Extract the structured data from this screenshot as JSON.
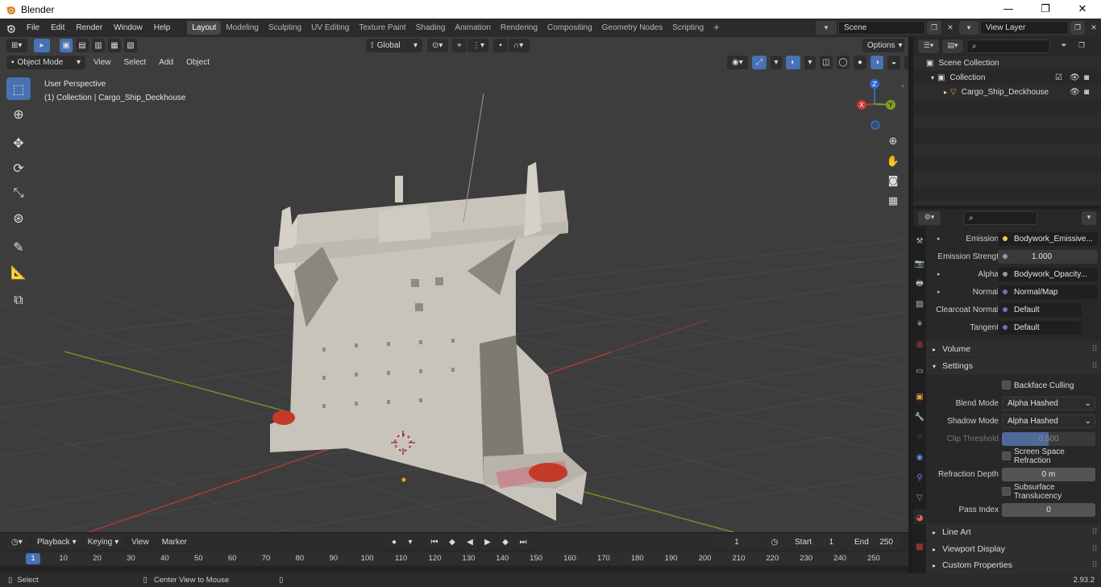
{
  "window": {
    "title": "Blender",
    "controls": [
      "—",
      "❐",
      "✕"
    ]
  },
  "menu": [
    "File",
    "Edit",
    "Render",
    "Window",
    "Help"
  ],
  "workspaces": [
    {
      "label": "Layout",
      "active": true
    },
    {
      "label": "Modeling"
    },
    {
      "label": "Sculpting"
    },
    {
      "label": "UV Editing"
    },
    {
      "label": "Texture Paint"
    },
    {
      "label": "Shading"
    },
    {
      "label": "Animation"
    },
    {
      "label": "Rendering"
    },
    {
      "label": "Compositing"
    },
    {
      "label": "Geometry Nodes"
    },
    {
      "label": "Scripting"
    }
  ],
  "add_workspace": "+",
  "scene": {
    "name": "Scene",
    "view_layer": "View Layer"
  },
  "viewport": {
    "transform_orientation": "Global",
    "options_label": "Options",
    "mode": "Object Mode",
    "menus": [
      "View",
      "Select",
      "Add",
      "Object"
    ],
    "overlay_title": "User Perspective",
    "overlay_subtitle": "(1) Collection | Cargo_Ship_Deckhouse",
    "gizmo": {
      "z": "Z",
      "y": "Y",
      "x": "X"
    }
  },
  "outliner": {
    "rows": [
      {
        "label": "Scene Collection"
      },
      {
        "label": "Collection"
      },
      {
        "label": "Cargo_Ship_Deckhouse"
      }
    ]
  },
  "properties": {
    "inputs": [
      {
        "label": "Emission",
        "value": "Bodywork_Emissive...",
        "dot": "#e8d23a"
      },
      {
        "label": "Emission Strengt",
        "value": "1.000",
        "dot": "#9a9a9a"
      },
      {
        "label": "Alpha",
        "value": "Bodywork_Opacity...",
        "dot": "#9a9a9a"
      },
      {
        "label": "Normal",
        "value": "Normal/Map",
        "dot": "#6b6fc8"
      },
      {
        "label": "Clearcoat Normal",
        "value": "Default",
        "dot": "#6b6fc8"
      },
      {
        "label": "Tangent",
        "value": "Default",
        "dot": "#6b6fc8"
      }
    ],
    "sections": {
      "volume": "Volume",
      "settings": "Settings",
      "line_art": "Line Art",
      "viewport_display": "Viewport Display",
      "custom_properties": "Custom Properties"
    },
    "settings": {
      "backface_culling": "Backface Culling",
      "blend_mode_label": "Blend Mode",
      "blend_mode_value": "Alpha Hashed",
      "shadow_mode_label": "Shadow Mode",
      "shadow_mode_value": "Alpha Hashed",
      "clip_threshold_label": "Clip Threshold",
      "clip_threshold_value": "0.500",
      "screen_space_refraction": "Screen Space Refraction",
      "refraction_depth_label": "Refraction Depth",
      "refraction_depth_value": "0 m",
      "subsurface_translucency": "Subsurface Translucency",
      "pass_index_label": "Pass Index",
      "pass_index_value": "0"
    }
  },
  "timeline": {
    "menus": [
      "Playback",
      "Keying",
      "View",
      "Marker"
    ],
    "current_frame": "1",
    "start_label": "Start",
    "start_value": "1",
    "end_label": "End",
    "end_value": "250",
    "ticks": [
      "1",
      "10",
      "20",
      "30",
      "40",
      "50",
      "60",
      "70",
      "80",
      "90",
      "100",
      "110",
      "120",
      "130",
      "140",
      "150",
      "160",
      "170",
      "180",
      "190",
      "200",
      "210",
      "220",
      "230",
      "240",
      "250"
    ]
  },
  "statusbar": {
    "left": "Select",
    "middle": "Center View to Mouse",
    "version": "2.93.2"
  }
}
